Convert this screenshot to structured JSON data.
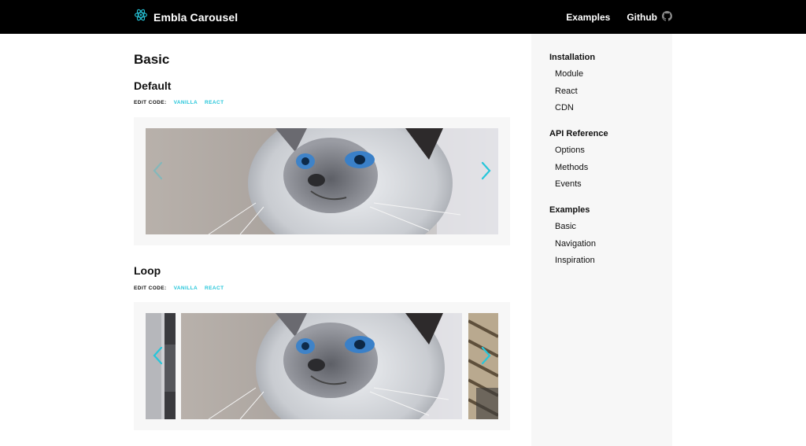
{
  "header": {
    "brand": "Embla Carousel",
    "nav": [
      {
        "label": "Examples"
      },
      {
        "label": "Github"
      }
    ]
  },
  "main": {
    "page_title": "Basic",
    "sections": [
      {
        "title": "Default",
        "edit_label": "EDIT CODE:",
        "links": [
          "VANILLA",
          "REACT"
        ]
      },
      {
        "title": "Loop",
        "edit_label": "EDIT CODE:",
        "links": [
          "VANILLA",
          "REACT"
        ]
      }
    ]
  },
  "sidebar": {
    "groups": [
      {
        "heading": "Installation",
        "items": [
          "Module",
          "React",
          "CDN"
        ]
      },
      {
        "heading": "API Reference",
        "items": [
          "Options",
          "Methods",
          "Events"
        ]
      },
      {
        "heading": "Examples",
        "items": [
          "Basic",
          "Navigation",
          "Inspiration"
        ]
      }
    ]
  },
  "colors": {
    "accent": "#26c6da",
    "header_bg": "#000000",
    "panel_bg": "#f7f7f7"
  },
  "icons": {
    "brand": "atom-logo-icon",
    "github": "github-icon",
    "prev": "chevron-left-icon",
    "next": "chevron-right-icon"
  }
}
